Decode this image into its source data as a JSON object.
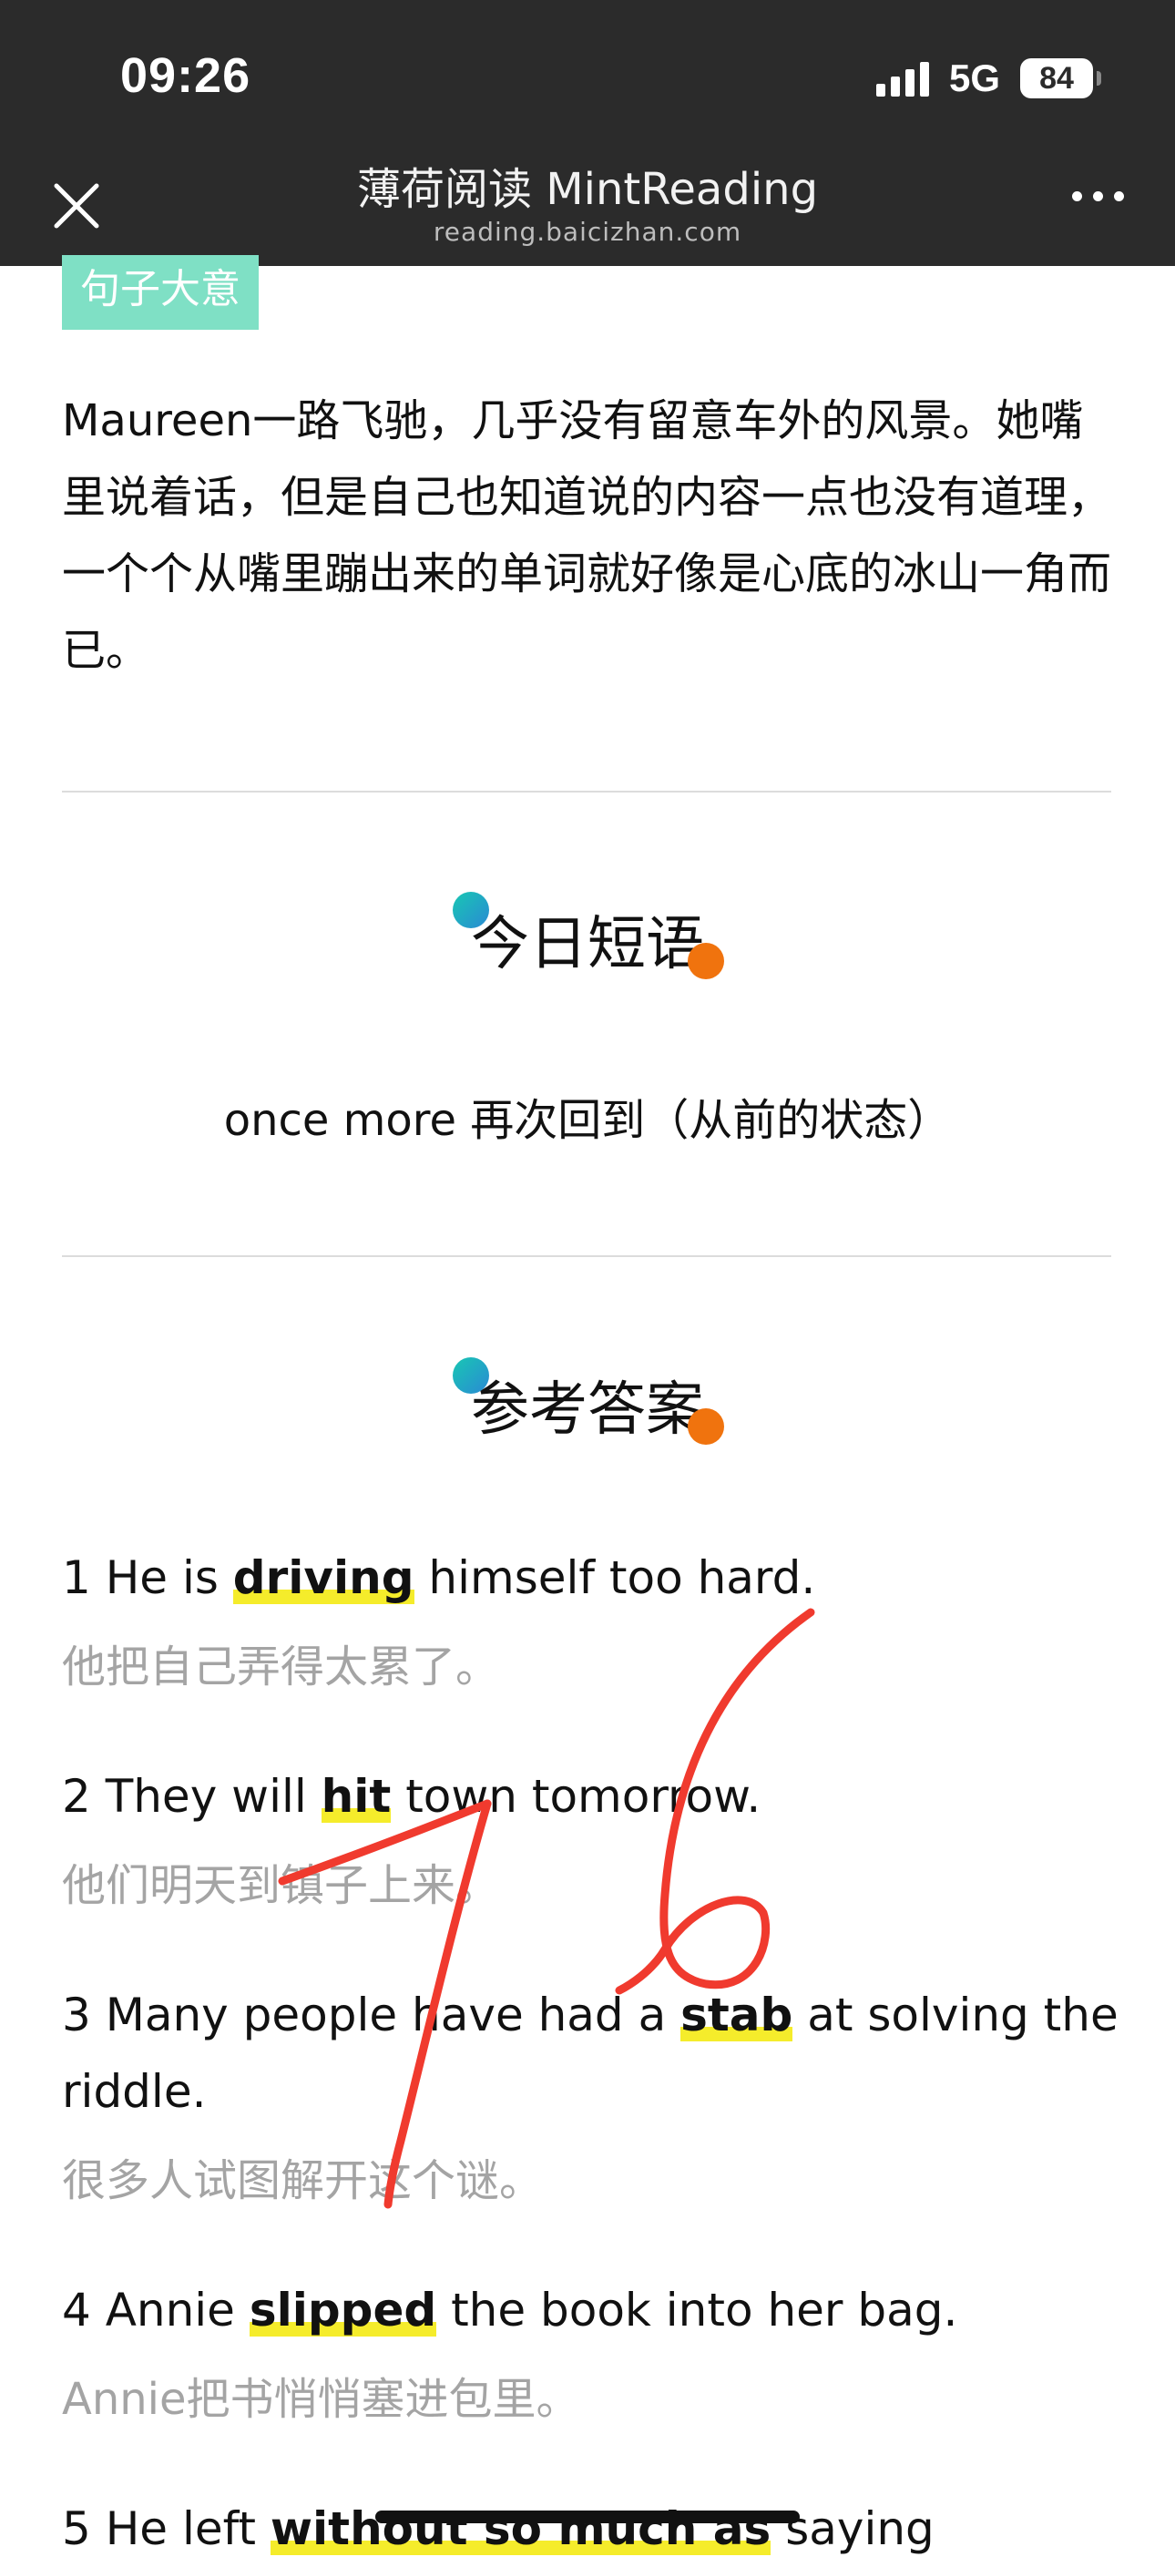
{
  "status_bar": {
    "time": "09:26",
    "network": "5G",
    "battery": "84"
  },
  "nav": {
    "title": "薄荷阅读 MintReading",
    "subtitle": "reading.baicizhan.com",
    "close_icon": "close-icon",
    "more_icon": "more-icon"
  },
  "sentence_meaning": {
    "tag": "句子大意",
    "text": "Maureen一路飞驰，几乎没有留意车外的风景。她嘴里说着话，但是自己也知道说的内容一点也没有道理，一个个从嘴里蹦出来的单词就好像是心底的冰山一角而已。"
  },
  "daily_phrase": {
    "title": "今日短语",
    "phrase": "once more 再次回到（从前的状态）"
  },
  "reference_answers": {
    "title": "参考答案",
    "items": [
      {
        "pre": "1 He is ",
        "key": "driving",
        "post": " himself too hard.",
        "zh": "他把自己弄得太累了。"
      },
      {
        "pre": "2 They will ",
        "key": "hit",
        "post": " town tomorrow.",
        "zh": "他们明天到镇子上来。"
      },
      {
        "pre": "3 Many people have had a ",
        "key": "stab",
        "post": " at solving the riddle.",
        "zh": "很多人试图解开这个谜。"
      },
      {
        "pre": "4 Annie ",
        "key": "slipped",
        "post": " the book into her bag.",
        "zh": "Annie把书悄悄塞进包里。"
      },
      {
        "pre": "5 He left ",
        "key": "without so much as",
        "post": " saying",
        "zh": ""
      }
    ]
  },
  "colors": {
    "topbar": "#2b2b2b",
    "tag_bg": "#7fe0c5",
    "highlight": "#f5ec2b",
    "scribble": "#f03a2e"
  }
}
